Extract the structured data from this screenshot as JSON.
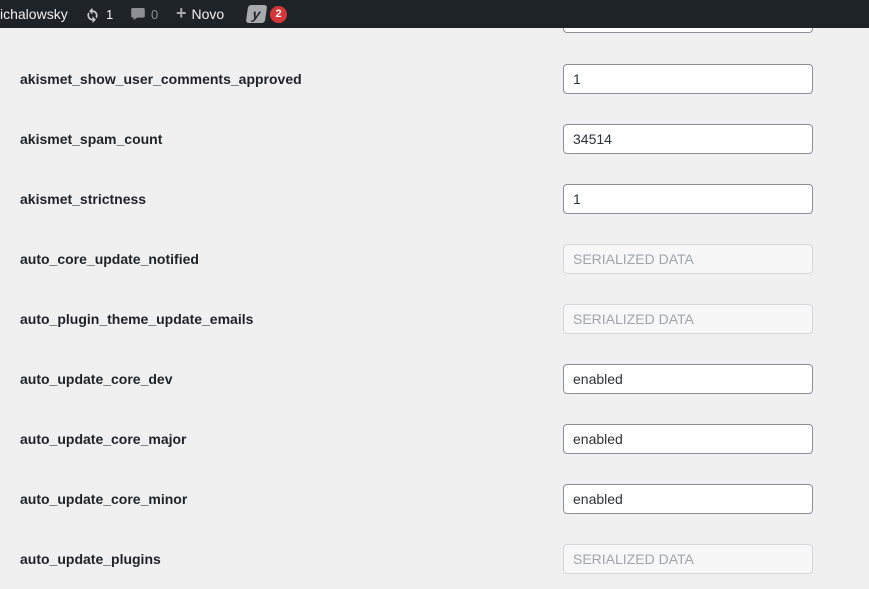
{
  "admin_bar": {
    "user_text": "ichalowsky",
    "updates_count": "1",
    "comments_count": "0",
    "new_label": "Novo",
    "yoast_letter": "y",
    "yoast_badge_count": "2"
  },
  "colors": {
    "admin_bar_bg": "#1d2327",
    "page_bg": "#f0f0f1",
    "badge_red": "#d63638",
    "input_border": "#8c8f94",
    "icon_gray": "#a7aaad"
  },
  "icons": {
    "update_icon": "circular-refresh-arrows",
    "comments_icon": "speech-bubble",
    "plus_icon": "+",
    "yoast_icon": "yoast-y-logo"
  },
  "options": {
    "rows": [
      {
        "name": "akismet_show_user_comments_approved",
        "value": "1",
        "disabled": false
      },
      {
        "name": "akismet_spam_count",
        "value": "34514",
        "disabled": false
      },
      {
        "name": "akismet_strictness",
        "value": "1",
        "disabled": false
      },
      {
        "name": "auto_core_update_notified",
        "value": "SERIALIZED DATA",
        "disabled": true
      },
      {
        "name": "auto_plugin_theme_update_emails",
        "value": "SERIALIZED DATA",
        "disabled": true
      },
      {
        "name": "auto_update_core_dev",
        "value": "enabled",
        "disabled": false
      },
      {
        "name": "auto_update_core_major",
        "value": "enabled",
        "disabled": false
      },
      {
        "name": "auto_update_core_minor",
        "value": "enabled",
        "disabled": false
      },
      {
        "name": "auto_update_plugins",
        "value": "SERIALIZED DATA",
        "disabled": true
      }
    ]
  }
}
